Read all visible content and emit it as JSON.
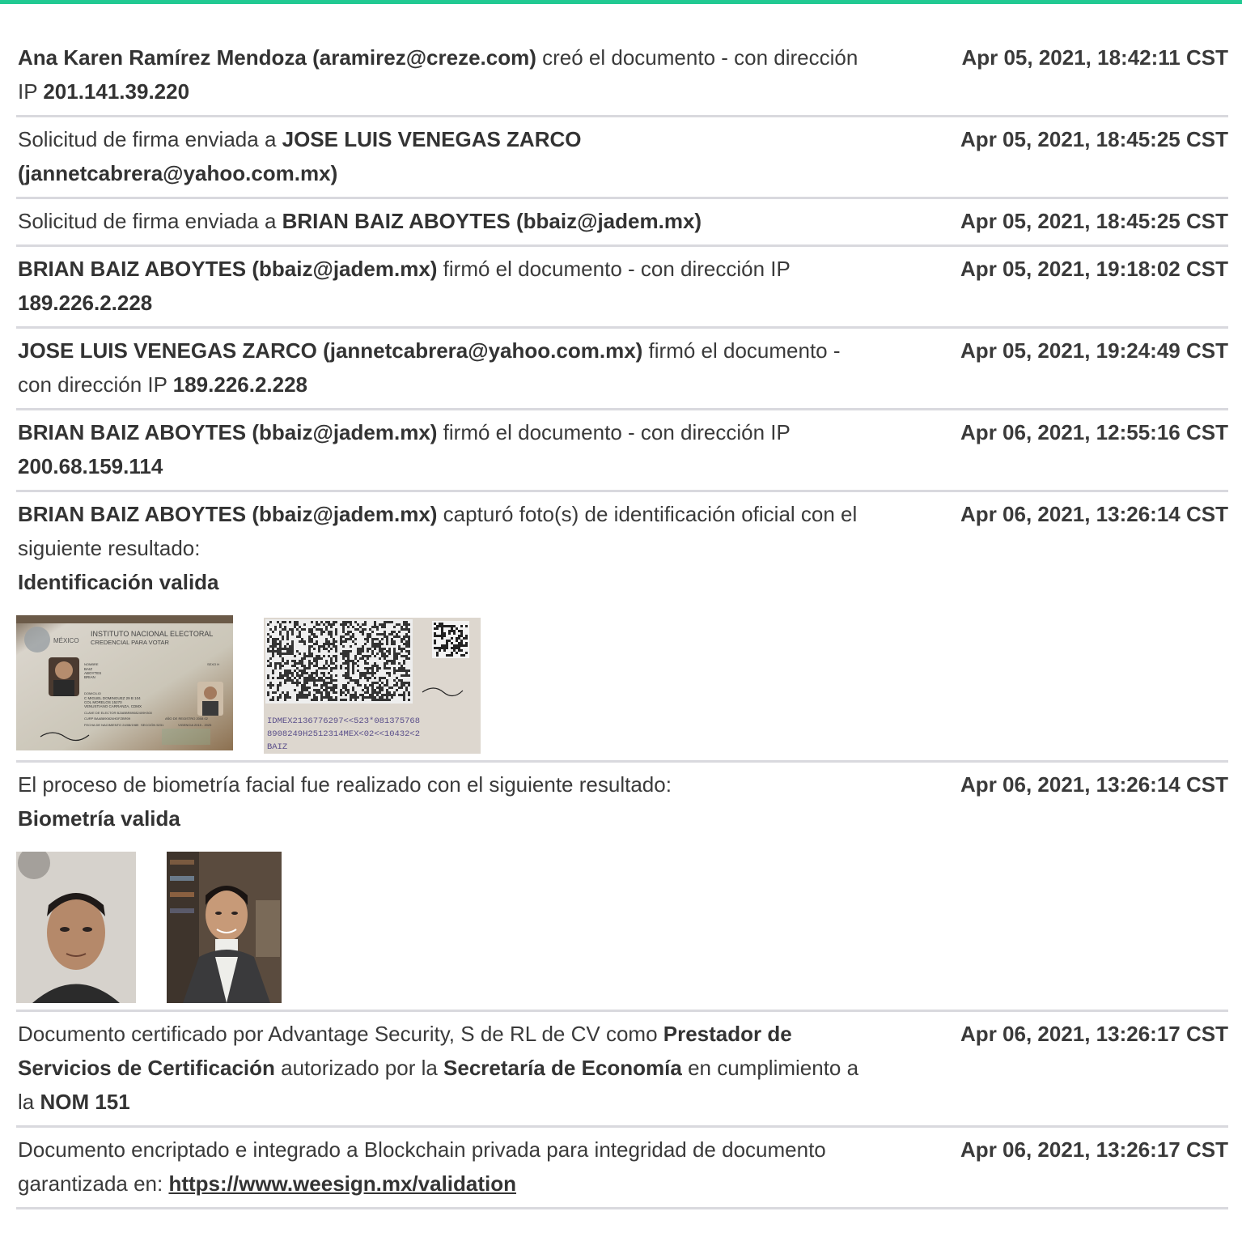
{
  "entries": [
    {
      "parts": [
        {
          "text": "Ana Karen Ramírez Mendoza (aramirez@creze.com)",
          "bold": true
        },
        {
          "text": " creó el documento - con dirección IP ",
          "bold": false
        },
        {
          "text": "201.141.39.220",
          "bold": true
        }
      ],
      "time": "Apr 05, 2021, 18:42:11 CST"
    },
    {
      "parts": [
        {
          "text": "Solicitud de firma enviada a ",
          "bold": false
        },
        {
          "text": "JOSE LUIS VENEGAS ZARCO (jannetcabrera@yahoo.com.mx)",
          "bold": true
        }
      ],
      "time": "Apr 05, 2021, 18:45:25 CST"
    },
    {
      "parts": [
        {
          "text": "Solicitud de firma enviada a ",
          "bold": false
        },
        {
          "text": "BRIAN BAIZ ABOYTES (bbaiz@jadem.mx)",
          "bold": true
        }
      ],
      "time": "Apr 05, 2021, 18:45:25 CST"
    },
    {
      "parts": [
        {
          "text": "BRIAN BAIZ ABOYTES (bbaiz@jadem.mx)",
          "bold": true
        },
        {
          "text": " firmó el documento - con dirección IP ",
          "bold": false
        },
        {
          "text": "189.226.2.228",
          "bold": true
        }
      ],
      "time": "Apr 05, 2021, 19:18:02 CST"
    },
    {
      "parts": [
        {
          "text": "JOSE LUIS VENEGAS ZARCO (jannetcabrera@yahoo.com.mx)",
          "bold": true
        },
        {
          "text": " firmó el documento - con dirección IP ",
          "bold": false
        },
        {
          "text": "189.226.2.228",
          "bold": true
        }
      ],
      "time": "Apr 05, 2021, 19:24:49 CST"
    },
    {
      "parts": [
        {
          "text": "BRIAN BAIZ ABOYTES (bbaiz@jadem.mx)",
          "bold": true
        },
        {
          "text": " firmó el documento - con dirección IP ",
          "bold": false
        },
        {
          "text": "200.68.159.114",
          "bold": true
        }
      ],
      "time": "Apr 06, 2021, 12:55:16 CST"
    },
    {
      "parts": [
        {
          "text": "BRIAN BAIZ ABOYTES (bbaiz@jadem.mx)",
          "bold": true
        },
        {
          "text": " capturó foto(s) de identificación oficial con el siguiente resultado:",
          "bold": false
        },
        {
          "text": "Identificación valida",
          "bold": true,
          "block": true
        }
      ],
      "time": "Apr 06, 2021, 13:26:14 CST",
      "images": "id"
    },
    {
      "parts": [
        {
          "text": "El proceso de biometría facial fue realizado con el siguiente resultado:",
          "bold": false
        },
        {
          "text": "Biometría valida",
          "bold": true,
          "block": true
        }
      ],
      "time": "Apr 06, 2021, 13:26:14 CST",
      "images": "face"
    },
    {
      "parts": [
        {
          "text": "Documento certificado por Advantage Security, S de RL de CV como ",
          "bold": false
        },
        {
          "text": "Prestador de Servicios de Certificación",
          "bold": true
        },
        {
          "text": " autorizado por la ",
          "bold": false
        },
        {
          "text": "Secretaría de Economía",
          "bold": true
        },
        {
          "text": " en cumplimiento a la ",
          "bold": false
        },
        {
          "text": "NOM 151",
          "bold": true
        }
      ],
      "time": "Apr 06, 2021, 13:26:17 CST"
    },
    {
      "parts": [
        {
          "text": "Documento encriptado e integrado a Blockchain privada para integridad de documento garantizada en: ",
          "bold": false
        },
        {
          "text": "https://www.weesign.mx/validation",
          "link": true
        }
      ],
      "time": "Apr 06, 2021, 13:26:17 CST"
    }
  ],
  "id_card": {
    "front": {
      "country": "MÉXICO",
      "institute": "INSTITUTO NACIONAL ELECTORAL",
      "doc": "CREDENCIAL PARA VOTAR",
      "name_label": "NOMBRE",
      "name": [
        "BAIZ",
        "ABOYTES",
        "BRIAN"
      ],
      "sex": "SEXO H",
      "address_label": "DOMICILIO",
      "address": [
        "C MIGUEL DOMINGUEZ 29 B 104",
        "COL MORELOS 15270",
        "VENUSTIANO CARRANZA, CDMX"
      ],
      "elector_key": "CLAVE DE ELECTOR  BZABBR89082409H300",
      "curp": "CURP  BAAB890824HDFZBR09",
      "registro": "AÑO DE REGISTRO  2008 02",
      "birth": "FECHA DE NACIMIENTO  24/08/1989",
      "section": "SECCIÓN  5231",
      "validity": "VIGENCIA  2015 - 2025"
    },
    "back": {
      "mrz": [
        "IDMEX2136776297<<523*081375768",
        "8908249H2512314MEX<02<<10432<2",
        "BAIZ<ABOYTES<<BRIAN<<<<<<<<<<"
      ]
    }
  }
}
